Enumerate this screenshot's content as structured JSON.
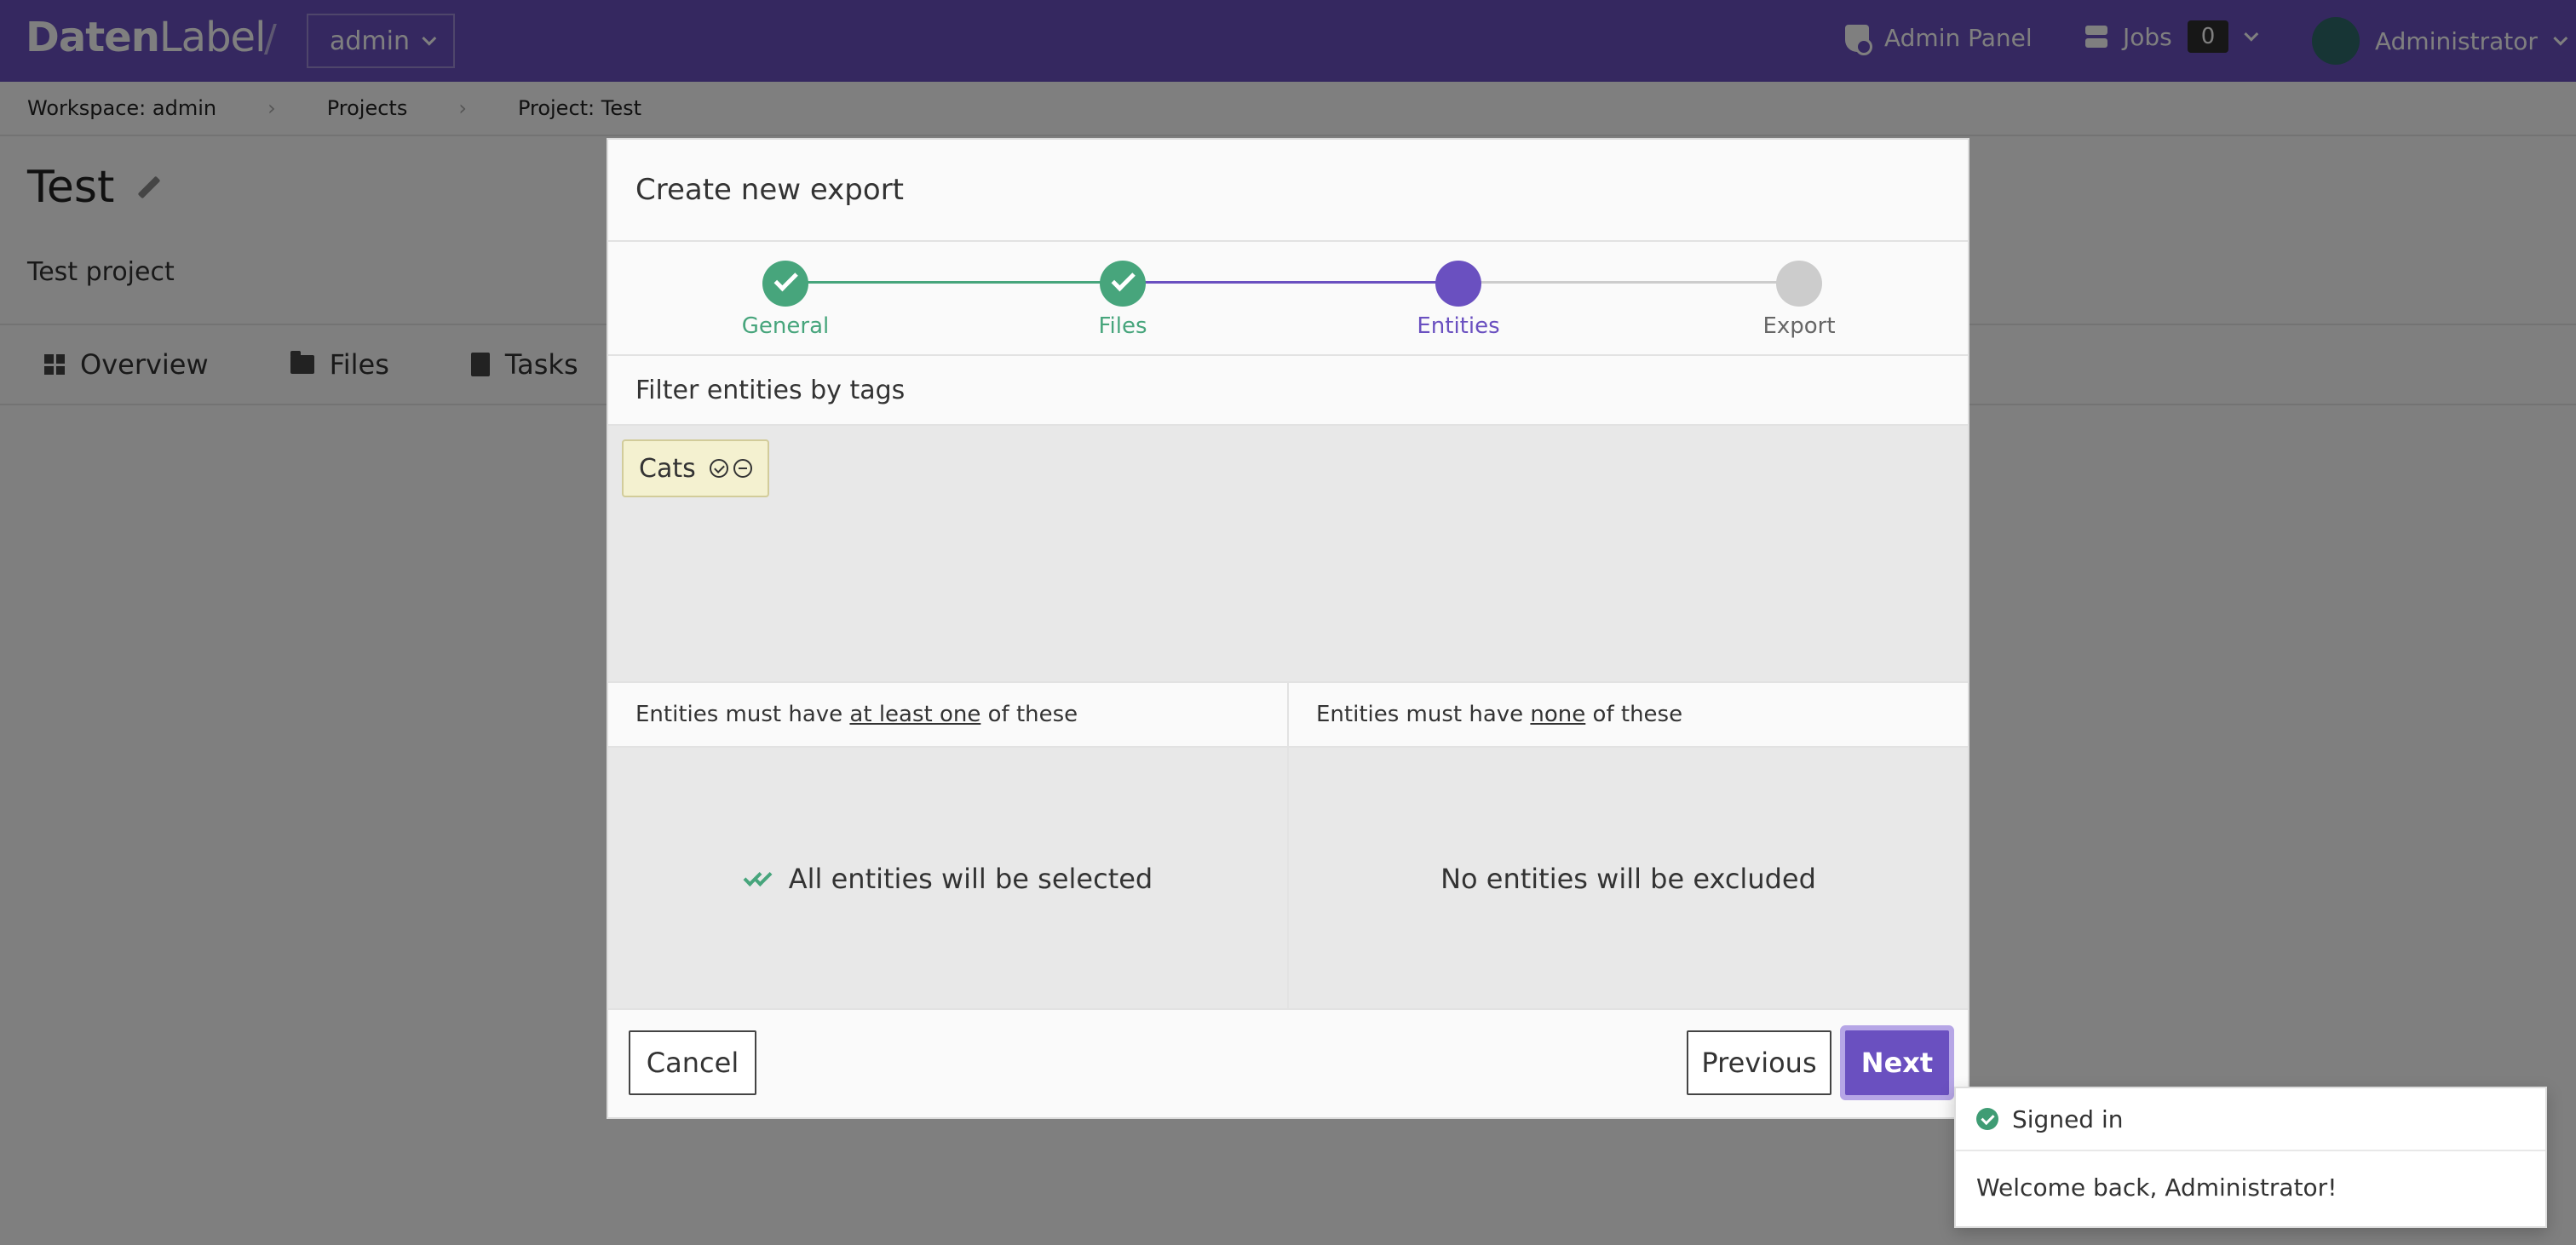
{
  "app": {
    "brand_bold": "Daten",
    "brand_light": "Label",
    "separator": "/",
    "workspace_select": "admin"
  },
  "topbar": {
    "admin_panel": "Admin Panel",
    "jobs_label": "Jobs",
    "jobs_count": "0",
    "user": "Administrator"
  },
  "breadcrumb": [
    "Workspace: admin",
    "Projects",
    "Project: Test"
  ],
  "project": {
    "title": "Test",
    "description": "Test project"
  },
  "tabs": [
    "Overview",
    "Files",
    "Tasks"
  ],
  "modal": {
    "title": "Create new export",
    "steps": [
      {
        "label": "General",
        "status": "done"
      },
      {
        "label": "Files",
        "status": "done"
      },
      {
        "label": "Entities",
        "status": "active"
      },
      {
        "label": "Export",
        "status": "pending"
      }
    ],
    "filter_title": "Filter entities by tags",
    "tags": [
      {
        "label": "Cats"
      }
    ],
    "include_head": {
      "prefix": "Entities must have ",
      "emph": "at least one",
      "suffix": " of these"
    },
    "exclude_head": {
      "prefix": "Entities must have ",
      "emph": "none",
      "suffix": " of these"
    },
    "include_body": "All entities will be selected",
    "exclude_body": "No entities will be excluded",
    "cancel": "Cancel",
    "previous": "Previous",
    "next": "Next"
  },
  "toast": {
    "title": "Signed in",
    "message": "Welcome back, Administrator!"
  },
  "colors": {
    "brand": "#6a50c0",
    "done": "#47a57c",
    "active": "#6a50c0",
    "pending": "#cccccc",
    "tag_bg": "#f4f1d0"
  },
  "icons": [
    "chevron-down-icon",
    "shield-icon",
    "server-icon",
    "pencil-icon",
    "dashboard-icon",
    "folder-icon",
    "document-icon",
    "check-icon",
    "check-circle-icon",
    "minus-circle-icon",
    "double-check-icon"
  ]
}
